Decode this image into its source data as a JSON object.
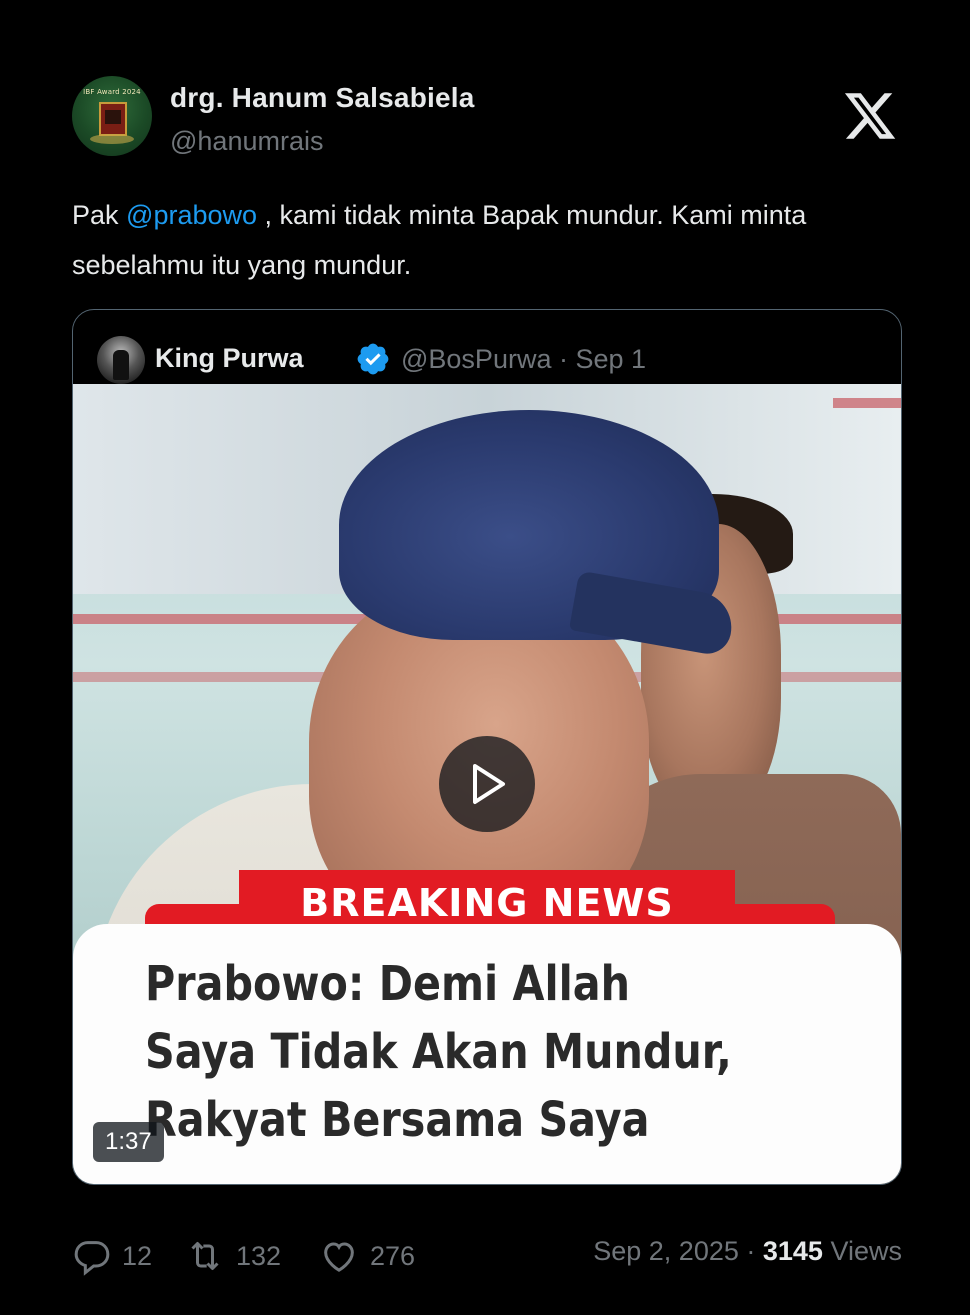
{
  "author": {
    "name": "drg. Hanum Salsabiela",
    "handle": "@hanumrais",
    "avatar_text": "IBF Award 2024"
  },
  "tweet": {
    "text_before": "Pak ",
    "mention": "@prabowo",
    "text_after": " , kami tidak minta Bapak mundur. Kami minta sebelahmu itu yang mundur."
  },
  "quoted": {
    "name": "King Purwa",
    "handle_date": "@BosPurwa · Sep 1",
    "video": {
      "banner": "BREAKING NEWS",
      "headline_line1": "Prabowo: Demi Allah",
      "headline_line2": "Saya Tidak Akan Mundur,",
      "headline_line3": "Rakyat Bersama Saya",
      "duration": "1:37"
    }
  },
  "stats": {
    "replies": "12",
    "retweets": "132",
    "likes": "276",
    "date": "Sep 2, 2025 · ",
    "views": "3145",
    "views_label": " Views"
  },
  "icons": {
    "platform": "x-logo-icon",
    "verified": "verified-badge-icon",
    "play": "play-icon",
    "reply": "reply-icon",
    "retweet": "retweet-icon",
    "like": "heart-icon"
  },
  "colors": {
    "background": "#000000",
    "text": "#e7e9ea",
    "muted": "#71767b",
    "link": "#1d9bf0",
    "verified": "#1d9bf0",
    "breaking": "#e21b23"
  }
}
